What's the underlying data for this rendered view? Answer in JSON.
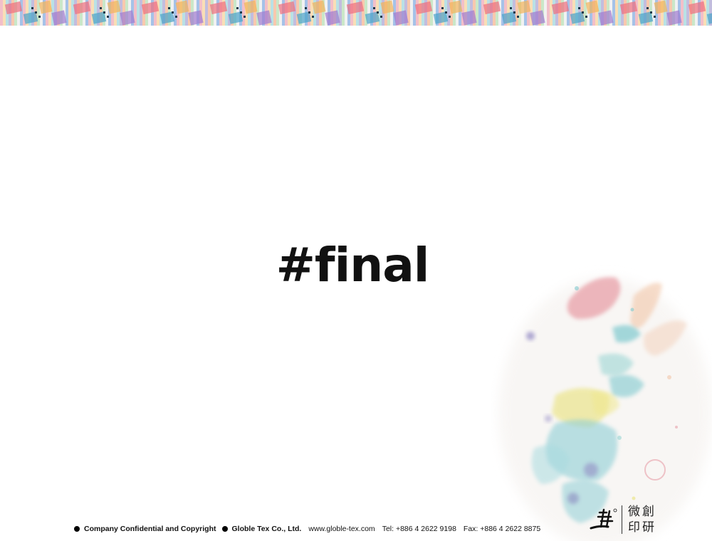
{
  "slide": {
    "title": "#final"
  },
  "footer": {
    "confidential": "Company Confidential and Copyright",
    "company": "Globle Tex Co., Ltd.",
    "website": "www.globle-tex.com",
    "tel": "Tel: +886 4 2622 9198",
    "fax": "Fax: +886 4 2622 8875"
  },
  "logo": {
    "line1": "微創",
    "line2": "印研"
  },
  "colors": {
    "title": "#111111",
    "footer_text": "#111111",
    "watercolor_pink": "#e8a0a8",
    "watercolor_teal": "#7fc9cf",
    "watercolor_yellow": "#e9e27a",
    "watercolor_purple": "#8f86c2"
  }
}
